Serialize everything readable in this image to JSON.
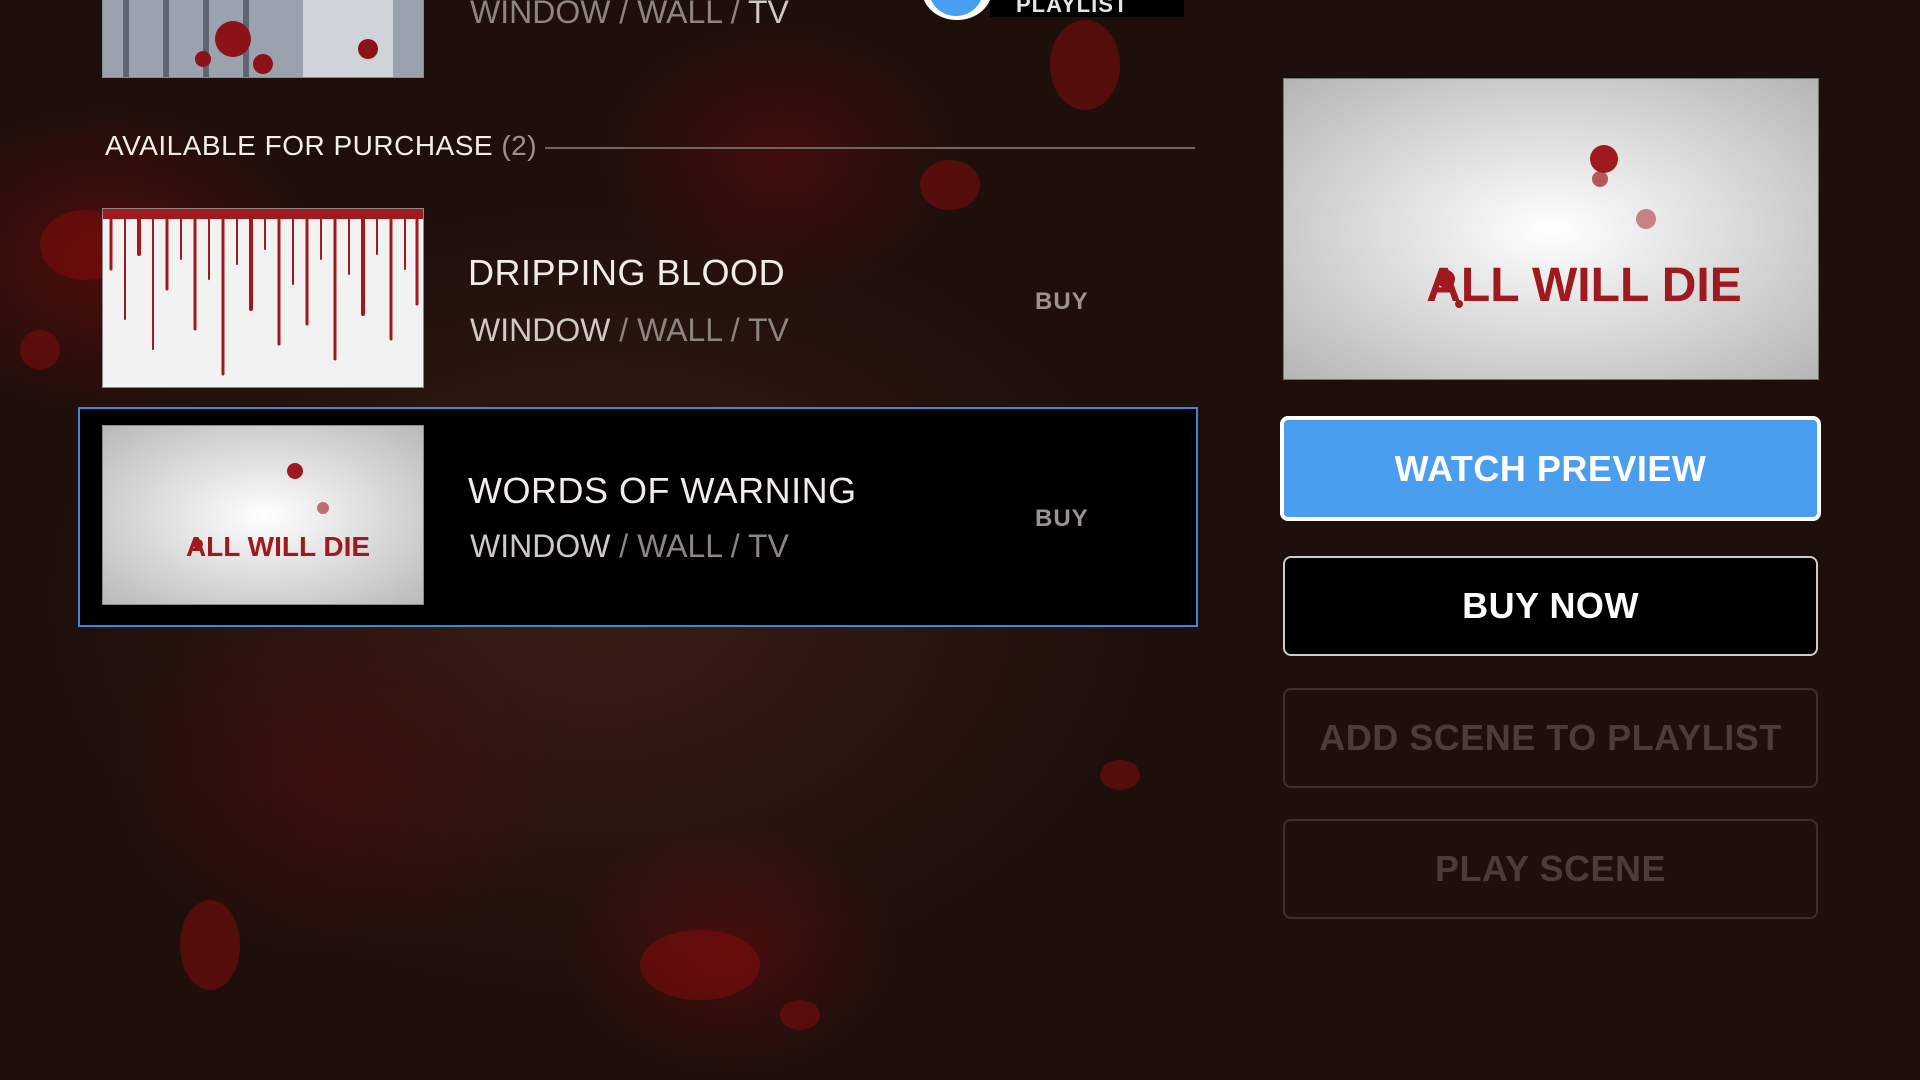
{
  "top_item": {
    "sub": {
      "window": "WINDOW",
      "wall": "WALL",
      "tv": "TV",
      "sep": "/"
    },
    "playlist_chip": "PLAYLIST"
  },
  "section": {
    "title": "AVAILABLE FOR PURCHASE",
    "count": "(2)"
  },
  "items": [
    {
      "title": "DRIPPING BLOOD",
      "sub": {
        "window": "WINDOW",
        "wall": "WALL",
        "tv": "TV",
        "sep": "/"
      },
      "buy": "BUY",
      "thumb_icon": "dripping-blood-thumbnail"
    },
    {
      "title": "WORDS OF WARNING",
      "sub": {
        "window": "WINDOW",
        "wall": "WALL",
        "tv": "TV",
        "sep": "/"
      },
      "buy": "BUY",
      "thumb_icon": "all-will-die-thumbnail",
      "thumb_text": "ALL WILL DIE",
      "selected": true
    }
  ],
  "panel": {
    "preview_text": "ALL WILL DIE",
    "watch_preview": "WATCH PREVIEW",
    "buy_now": "BUY NOW",
    "add_scene": "ADD SCENE TO PLAYLIST",
    "play_scene": "PLAY SCENE"
  },
  "colors": {
    "accent": "#4a9ef0",
    "selection_border": "#3f86d6",
    "blood": "#9e1a1f"
  }
}
